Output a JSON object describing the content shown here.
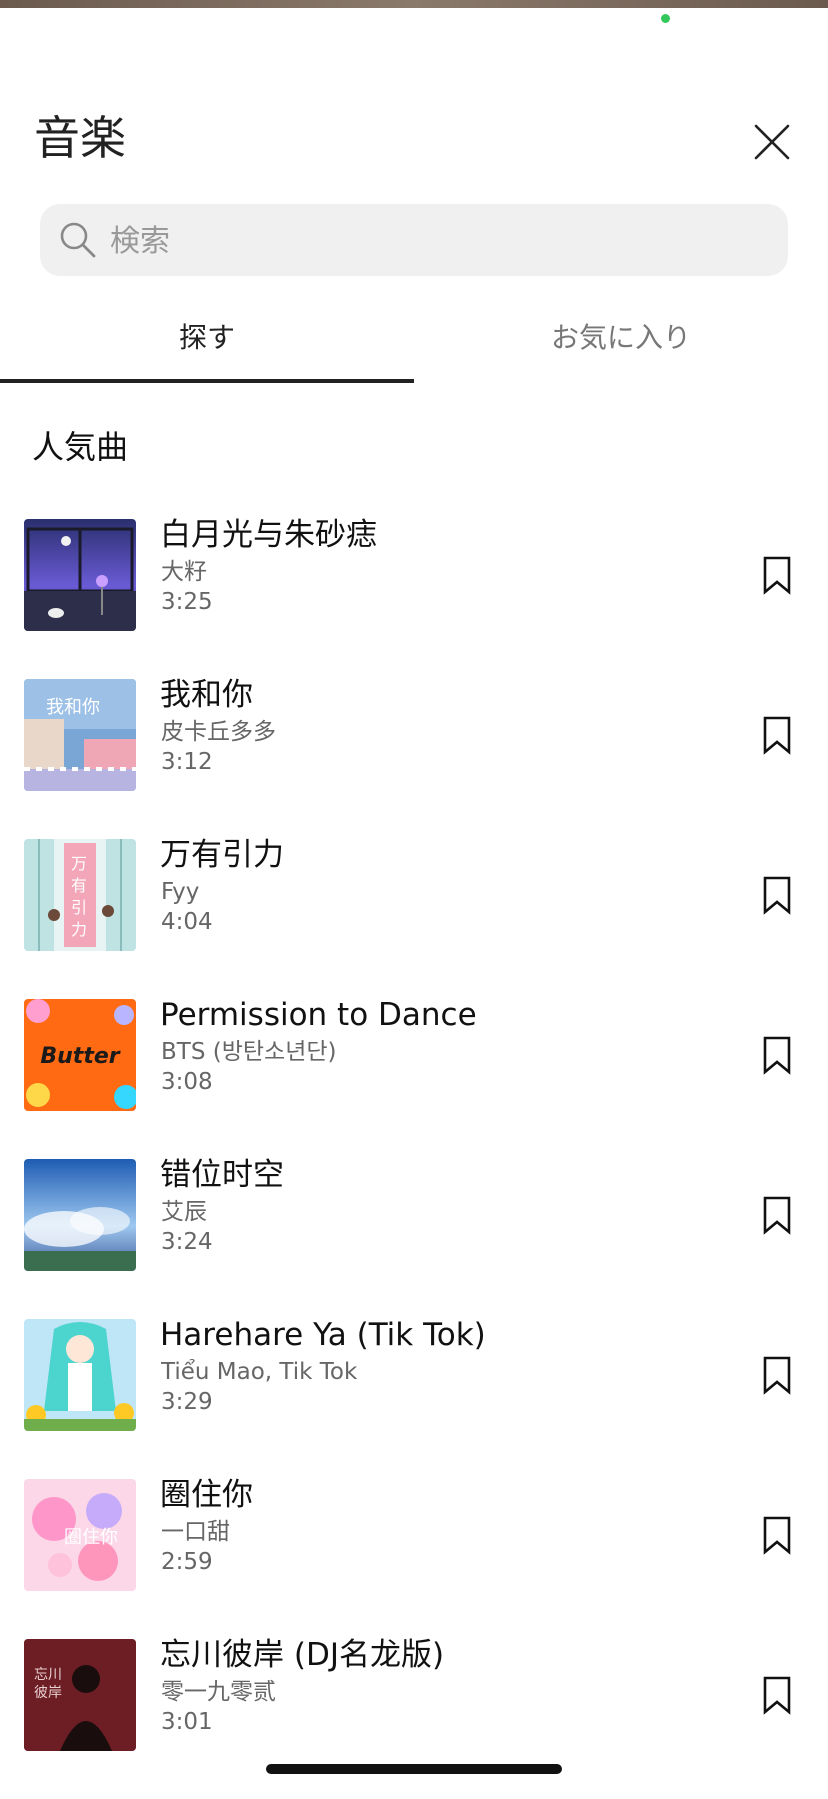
{
  "header": {
    "title": "音楽"
  },
  "search": {
    "placeholder": "検索"
  },
  "tabs": [
    {
      "label": "探す",
      "active": true
    },
    {
      "label": "お気に入り",
      "active": false
    }
  ],
  "section": {
    "title": "人気曲"
  },
  "songs": [
    {
      "title": "白月光与朱砂痣",
      "artist": "大籽",
      "duration": "3:25"
    },
    {
      "title": "我和你",
      "artist": "皮卡丘多多",
      "duration": "3:12"
    },
    {
      "title": "万有引力",
      "artist": "Fyy",
      "duration": "4:04"
    },
    {
      "title": "Permission to Dance",
      "artist": "BTS (방탄소년단)",
      "duration": "3:08"
    },
    {
      "title": "错位时空",
      "artist": "艾辰",
      "duration": "3:24"
    },
    {
      "title": "Harehare Ya (Tik Tok)",
      "artist": "Tiểu Mao, Tik Tok",
      "duration": "3:29"
    },
    {
      "title": "圈住你",
      "artist": "一口甜",
      "duration": "2:59"
    },
    {
      "title": "忘川彼岸 (DJ名龙版)",
      "artist": "零一九零贰",
      "duration": "3:01"
    }
  ],
  "cover_art": {
    "butter_text": "Butter"
  },
  "colors": {
    "accent": "#222222",
    "search_bg": "#f0f0f0",
    "status_dot": "#34c759"
  }
}
